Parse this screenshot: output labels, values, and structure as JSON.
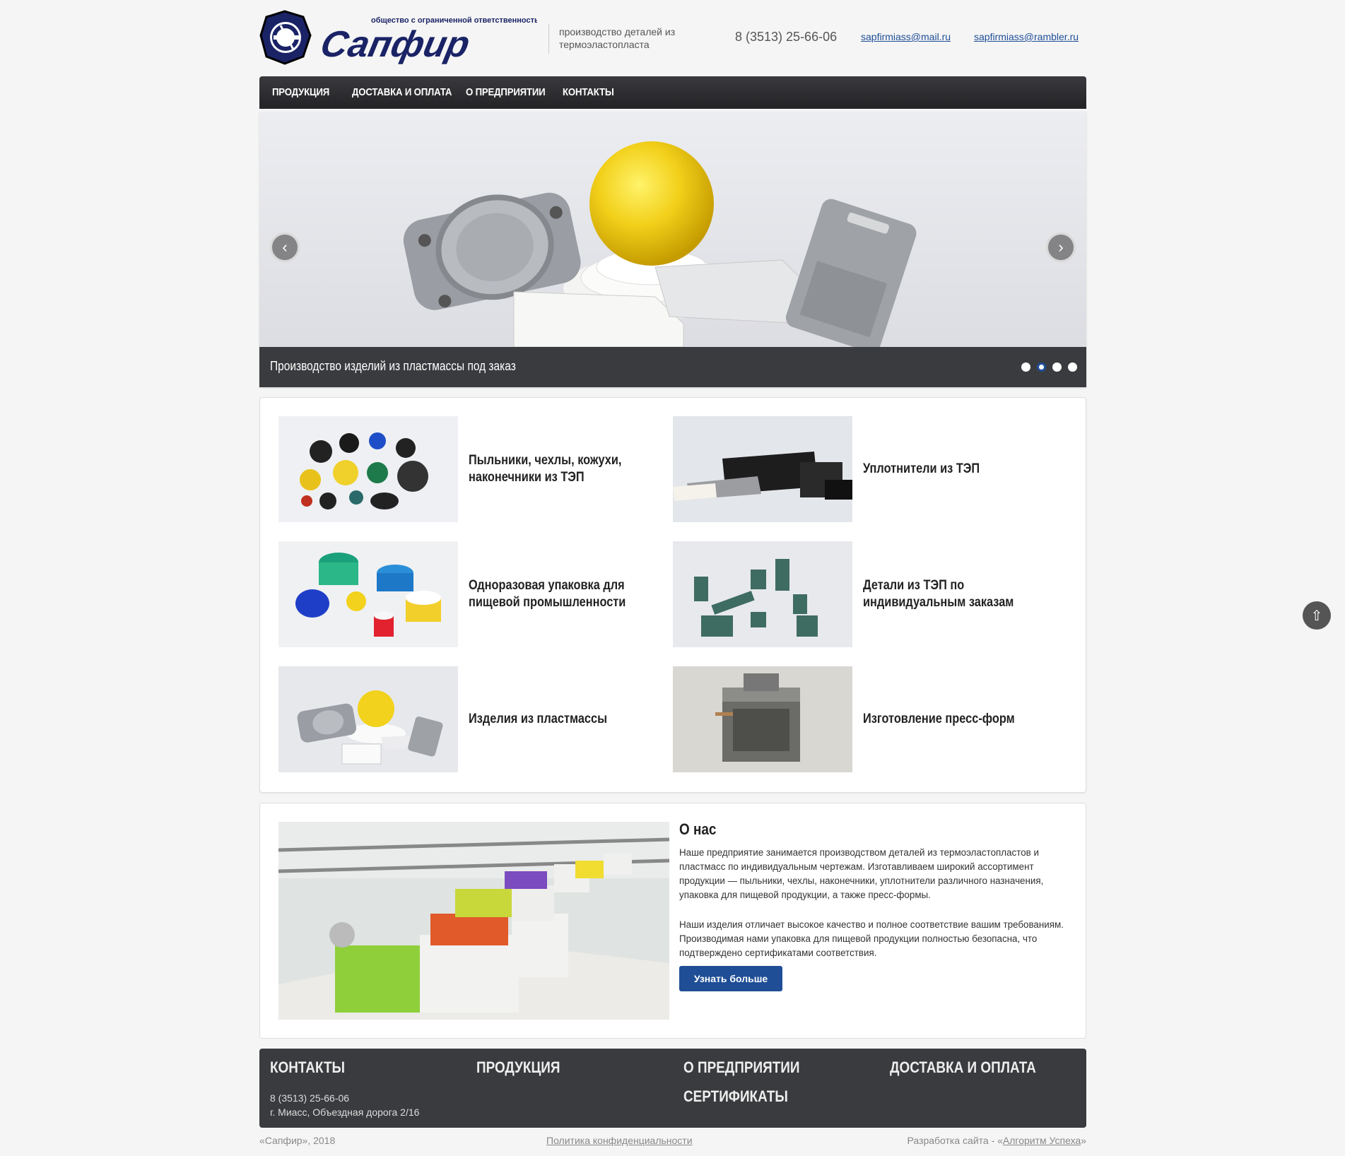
{
  "header": {
    "logo_text": "Сапфир",
    "logo_subtitle": "общество с ограниченной ответственностью",
    "tagline": "производство деталей из термоэластопласта",
    "phone": "8 (3513) 25-66-06",
    "email1": "sapfirmiass@mail.ru",
    "email2": "sapfirmiass@rambler.ru"
  },
  "nav": {
    "items": [
      "ПРОДУКЦИЯ",
      "ДОСТАВКА И ОПЛАТА",
      "О ПРЕДПРИЯТИИ",
      "КОНТАКТЫ"
    ]
  },
  "slider": {
    "caption": "Производство изделий из пластмассы под заказ",
    "prev_icon": "chevron-left-icon",
    "next_icon": "chevron-right-icon",
    "active_dot": 2,
    "dot_count": 4
  },
  "products": [
    {
      "title": "Пыльники, чехлы, кожухи, наконечники из ТЭП"
    },
    {
      "title": "Уплотнители из ТЭП"
    },
    {
      "title": "Одноразовая упаковка для пищевой промышленности"
    },
    {
      "title": "Детали из ТЭП по индивидуальным заказам"
    },
    {
      "title": "Изделия из пластмассы"
    },
    {
      "title": "Изготовление пресс-форм"
    }
  ],
  "about": {
    "title": "О нас",
    "p1": "Наше предприятие занимается производством деталей из термоэластопластов и пластмасс по индивидуальным чертежам. Изготавливаем широкий ассортимент продукции — пыльники, чехлы, наконечники, уплотнители различного назначения, упаковка для пищевой продукции, а также пресс-формы.",
    "p2": "Наши изделия отличает высокое качество и полное соответствие вашим требованиям. Производимая нами упаковка для пищевой продукции полностью безопасна, что подтверждено сертификатами соответствия.",
    "button": "Узнать больше"
  },
  "footer": {
    "contacts_title": "КОНТАКТЫ",
    "phone": "8 (3513) 25-66-06",
    "address": "г. Миасс, Объездная дорога 2/16",
    "products_title": "ПРОДУКЦИЯ",
    "about_title": "О ПРЕДПРИЯТИИ",
    "certs_title": "СЕРТИФИКАТЫ",
    "delivery_title": "ДОСТАВКА И ОПЛАТА"
  },
  "bottom": {
    "copyright": "«Сапфир», 2018",
    "privacy": "Политика конфиденциальности",
    "dev_prefix": "Разработка сайта - «",
    "dev_link": "Алгоритм Успеха",
    "dev_suffix": "»"
  },
  "colors": {
    "accent": "#1f4e96",
    "dark": "#3a3b3e",
    "logo_navy": "#1a2366"
  }
}
